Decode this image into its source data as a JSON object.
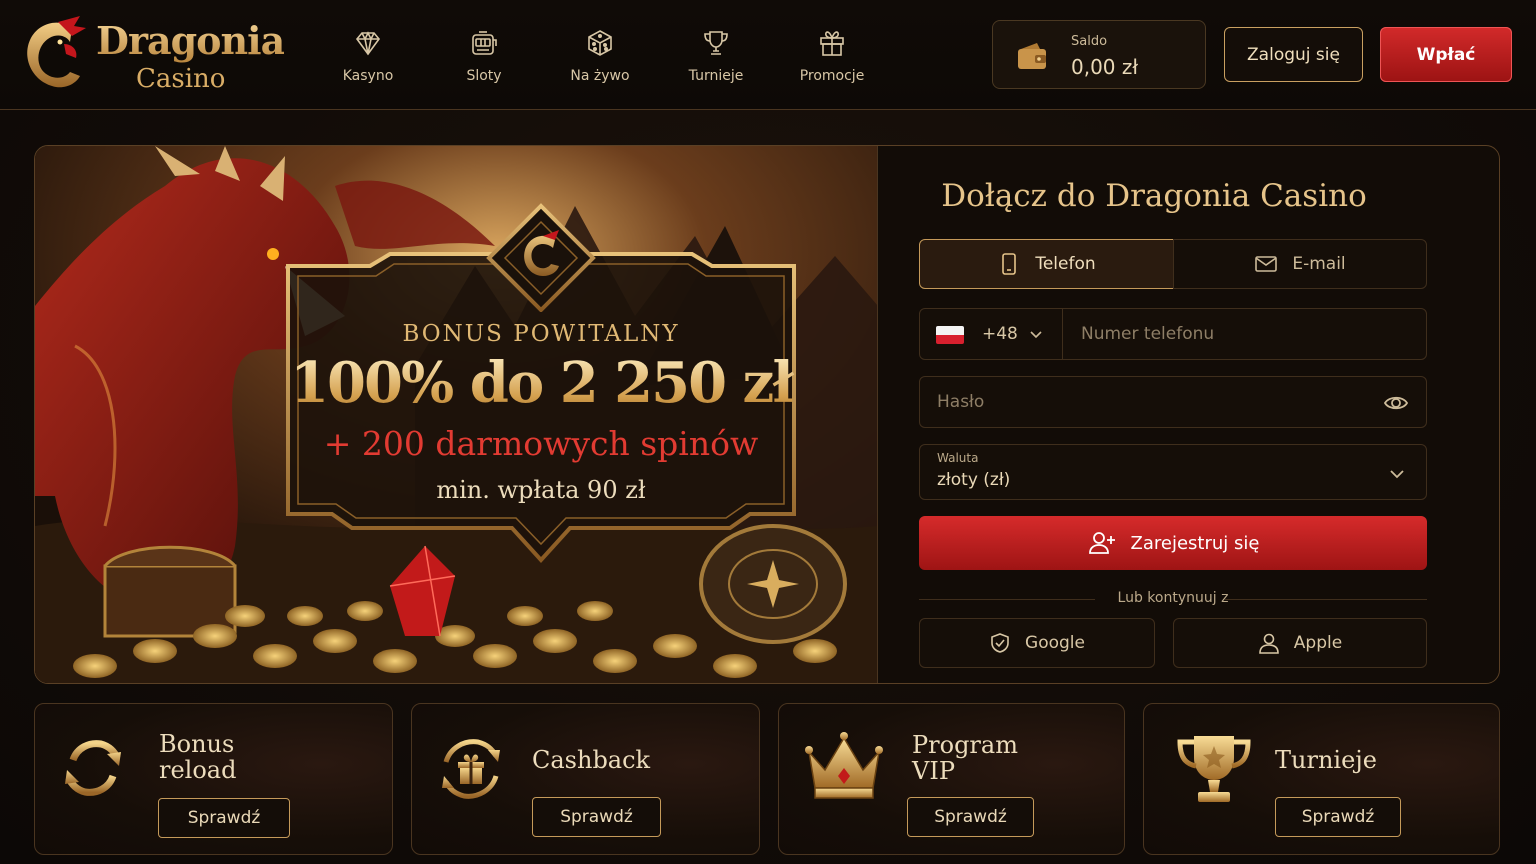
{
  "brand": {
    "name": "Dragonia",
    "sub": "Casino"
  },
  "nav": [
    {
      "label": "Kasyno",
      "icon": "diamond-icon"
    },
    {
      "label": "Sloty",
      "icon": "slot-machine-icon"
    },
    {
      "label": "Na żywo",
      "icon": "dice-icon"
    },
    {
      "label": "Turnieje",
      "icon": "trophy-icon"
    },
    {
      "label": "Promocje",
      "icon": "gift-icon"
    }
  ],
  "balance": {
    "label": "Saldo",
    "value": "0,00 zł",
    "icon": "wallet-icon"
  },
  "header_buttons": {
    "login": "Zaloguj się",
    "deposit": "Wpłać"
  },
  "bonus": {
    "title": "BONUS POWITALNY",
    "amount": "100% do 2 250 zł",
    "spins": "+ 200 darmowych spinów",
    "min_deposit": "min. wpłata 90 zł"
  },
  "form": {
    "title": "Dołącz do Dragonia Casino",
    "tabs": {
      "phone": "Telefon",
      "email": "E-mail",
      "active": "phone"
    },
    "country_code": "+48",
    "phone_placeholder": "Numer telefonu",
    "password_placeholder": "Hasło",
    "currency_label": "Waluta",
    "currency_value": "złoty (zł)",
    "register": "Zarejestruj się",
    "or_text": "Lub kontynuuj z",
    "google": "Google",
    "apple": "Apple"
  },
  "promos": [
    {
      "title_line1": "Bonus",
      "title_line2": "reload",
      "button": "Sprawdź",
      "icon": "reload-icon"
    },
    {
      "title_line1": "Cashback",
      "title_line2": "",
      "button": "Sprawdź",
      "icon": "cashback-gift-icon"
    },
    {
      "title_line1": "Program",
      "title_line2": "VIP",
      "button": "Sprawdź",
      "icon": "crown-icon"
    },
    {
      "title_line1": "Turnieje",
      "title_line2": "",
      "button": "Sprawdź",
      "icon": "trophy-icon"
    }
  ],
  "colors": {
    "accent_gold": "#d4a04e",
    "accent_red": "#c41e1e",
    "bg": "#120c08"
  }
}
